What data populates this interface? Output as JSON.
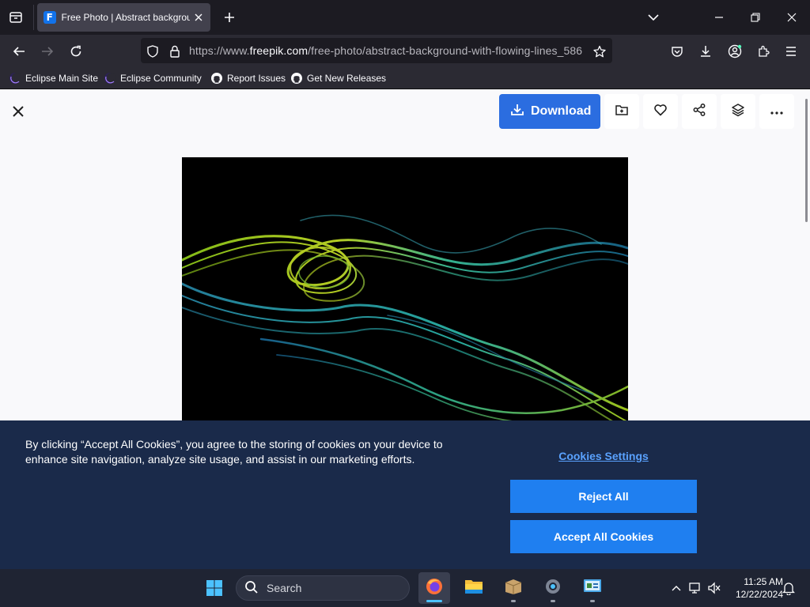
{
  "browser": {
    "tab": {
      "title": "Free Photo | Abstract background with flowing lines"
    },
    "url": {
      "prefix": "https://www.",
      "host": "freepik.com",
      "path": "/free-photo/abstract-background-with-flowing-lines_586"
    },
    "bookmarks": [
      {
        "label": "Eclipse Main Site",
        "icon": "eclipse-icon"
      },
      {
        "label": "Eclipse Community",
        "icon": "eclipse-icon"
      },
      {
        "label": "Report Issues",
        "icon": "github-icon"
      },
      {
        "label": "Get New Releases",
        "icon": "github-icon"
      }
    ]
  },
  "page": {
    "download_label": "Download",
    "actions": [
      "add-to-collection-icon",
      "heart-icon",
      "share-icon",
      "layers-icon",
      "more-icon"
    ]
  },
  "cookie_banner": {
    "text": "By clicking “Accept All Cookies”, you agree to the storing of cookies on your device to enhance site navigation, analyze site usage, and assist in our marketing efforts.",
    "settings_label": "Cookies Settings",
    "reject_label": "Reject All",
    "accept_label": "Accept All Cookies"
  },
  "taskbar": {
    "search_placeholder": "Search",
    "apps": [
      "windows-start-icon",
      "firefox-icon",
      "file-explorer-icon",
      "archive-app-icon",
      "settings-icon",
      "control-panel-icon"
    ],
    "time": "11:25 AM",
    "date": "12/22/2024"
  },
  "colors": {
    "accent": "#2b6de0",
    "cookie_bg": "#1a2a4a",
    "cookie_button": "#1f7ff0",
    "cookie_link": "#5aa2ff"
  }
}
